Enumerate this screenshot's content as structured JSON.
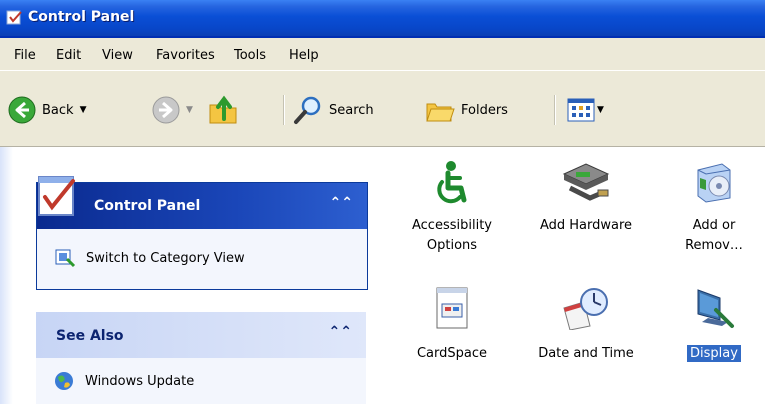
{
  "window": {
    "title": "Control Panel",
    "icon": "control-panel-icon"
  },
  "menu": [
    "File",
    "Edit",
    "View",
    "Favorites",
    "Tools",
    "Help"
  ],
  "toolbar": {
    "back_label": "Back",
    "search_label": "Search",
    "folders_label": "Folders"
  },
  "left_pane": {
    "control_panel_box": {
      "title": "Control Panel",
      "tasks": [
        "Switch to Category View"
      ]
    },
    "see_also_box": {
      "title": "See Also",
      "links": [
        "Windows Update"
      ]
    }
  },
  "items": [
    {
      "label_line1": "Accessibility",
      "label_line2": "Options",
      "icon": "accessibility-icon"
    },
    {
      "label_line1": "Add Hardware",
      "label_line2": "",
      "icon": "add-hardware-icon"
    },
    {
      "label_line1": "Add or",
      "label_line2": "Remov…",
      "icon": "add-remove-programs-icon"
    },
    {
      "label_line1": "CardSpace",
      "label_line2": "",
      "icon": "cardspace-icon"
    },
    {
      "label_line1": "Date and Time",
      "label_line2": "",
      "icon": "date-time-icon"
    },
    {
      "label_line1": "Display",
      "label_line2": "",
      "icon": "display-icon",
      "selected": true
    }
  ],
  "colors": {
    "titlebar": "#0a4fd6",
    "panel_header": "#0a2a8f",
    "selection": "#316ac5",
    "chrome": "#ece9d8"
  }
}
